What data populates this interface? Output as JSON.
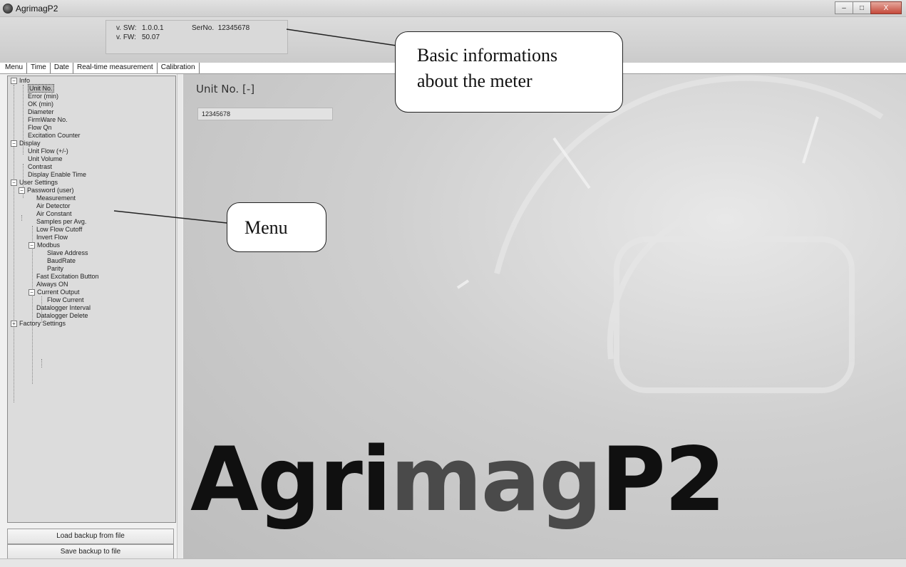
{
  "window": {
    "title": "AgrimagP2",
    "controls": {
      "minimize": "–",
      "maximize": "□",
      "close": "X"
    }
  },
  "info": {
    "sw_label": "v. SW:",
    "sw_value": "1.0.0.1",
    "fw_label": "v. FW:",
    "fw_value": "50.07",
    "serno_label": "SerNo.",
    "serno_value": "12345678"
  },
  "tabs": [
    "Menu",
    "Time",
    "Date",
    "Real-time measurement",
    "Calibration"
  ],
  "tree": {
    "info": "Info",
    "unit_no": "Unit No.",
    "error_min": "Error (min)",
    "ok_min": "OK (min)",
    "diameter": "Diameter",
    "firmware_no": "FirmWare No.",
    "flow_qn": "Flow Qn",
    "excitation_counter": "Excitation Counter",
    "display": "Display",
    "unit_flow": "Unit Flow (+/-)",
    "unit_volume": "Unit Volume",
    "contrast": "Contrast",
    "display_enable_time": "Display Enable Time",
    "user_settings": "User Settings",
    "password_user": "Password (user)",
    "measurement": "Measurement",
    "air_detector": "Air Detector",
    "air_constant": "Air Constant",
    "samples_per_avg": "Samples per Avg.",
    "low_flow_cutoff": "Low Flow Cutoff",
    "invert_flow": "Invert Flow",
    "modbus": "Modbus",
    "slave_address": "Slave Address",
    "baudrate": "BaudRate",
    "parity": "Parity",
    "fast_excitation_button": "Fast Excitation Button",
    "always_on": "Always ON",
    "current_output": "Current Output",
    "flow_current": "Flow Current",
    "datalogger_interval": "Datalogger Interval",
    "datalogger_delete": "Datalogger Delete",
    "factory_settings": "Factory Settings",
    "expanded_glyph": "−",
    "collapsed_glyph": "+"
  },
  "buttons": {
    "load_backup": "Load backup from file",
    "save_backup": "Save backup to file"
  },
  "main": {
    "param_title": "Unit No. [-]",
    "param_value": "12345678",
    "logo_dark": "Agri",
    "logo_mid": "mag",
    "logo_dark2": "P2"
  },
  "callouts": {
    "basic_info_line1": "Basic informations",
    "basic_info_line2": "about the meter",
    "menu": "Menu"
  }
}
